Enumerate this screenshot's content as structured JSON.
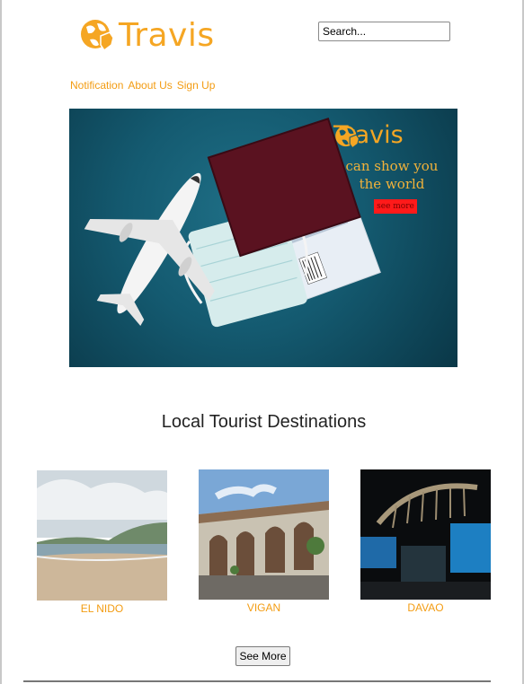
{
  "brand": {
    "name": "Travis",
    "logo_icon": "globe-hand-icon",
    "color": "#f5a623"
  },
  "search": {
    "placeholder": "Search..."
  },
  "nav": {
    "items": [
      {
        "label": "Notification"
      },
      {
        "label": "About Us"
      },
      {
        "label": "Sign Up"
      }
    ],
    "color": "#f39c12"
  },
  "hero": {
    "brand_name": "Travis",
    "tagline": "can show you the world",
    "button_label": "see more",
    "button_color": "#ff1a1a",
    "image_subject": "airplane-passport-mask-photo"
  },
  "destinations": {
    "title": "Local Tourist Destinations",
    "items": [
      {
        "name": "EL NIDO",
        "image": "beach-photo"
      },
      {
        "name": "VIGAN",
        "image": "heritage-street-photo"
      },
      {
        "name": "DAVAO",
        "image": "museum-skeleton-photo"
      }
    ],
    "button_label": "See More"
  }
}
